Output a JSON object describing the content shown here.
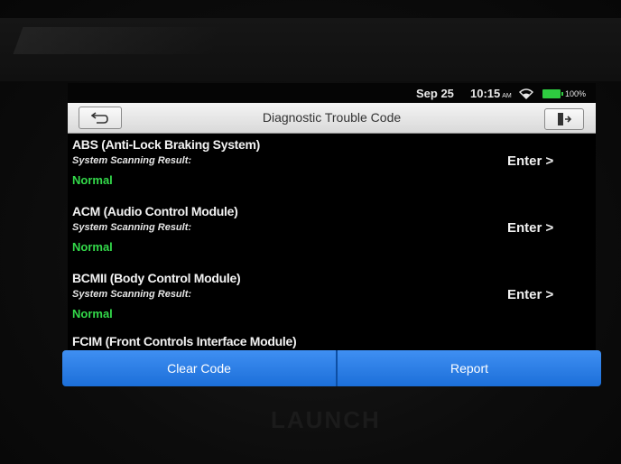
{
  "status_bar": {
    "date": "Sep 25",
    "time": "10:15",
    "ampm": "AM",
    "battery_percent": "100%",
    "wifi_icon": "wifi-icon",
    "battery_icon": "battery-icon",
    "battery_color": "#2ecc40"
  },
  "header": {
    "title": "Diagnostic Trouble Code",
    "back_icon": "back-arrow-icon",
    "exit_icon": "exit-icon"
  },
  "systems": [
    {
      "name": "ABS (Anti-Lock Braking System)",
      "sublabel": "System Scanning Result:",
      "status": "Normal",
      "action": "Enter >"
    },
    {
      "name": "ACM (Audio Control Module)",
      "sublabel": "System Scanning Result:",
      "status": "Normal",
      "action": "Enter >"
    },
    {
      "name": "BCMII (Body Control Module)",
      "sublabel": "System Scanning Result:",
      "status": "Normal",
      "action": "Enter >"
    },
    {
      "name": "FCIM (Front Controls Interface Module)"
    }
  ],
  "footer": {
    "clear_label": "Clear Code",
    "report_label": "Report"
  },
  "device": {
    "brand": "LAUNCH"
  },
  "colors": {
    "status_normal": "#33d94a",
    "button_blue": "#2a7fe8"
  }
}
